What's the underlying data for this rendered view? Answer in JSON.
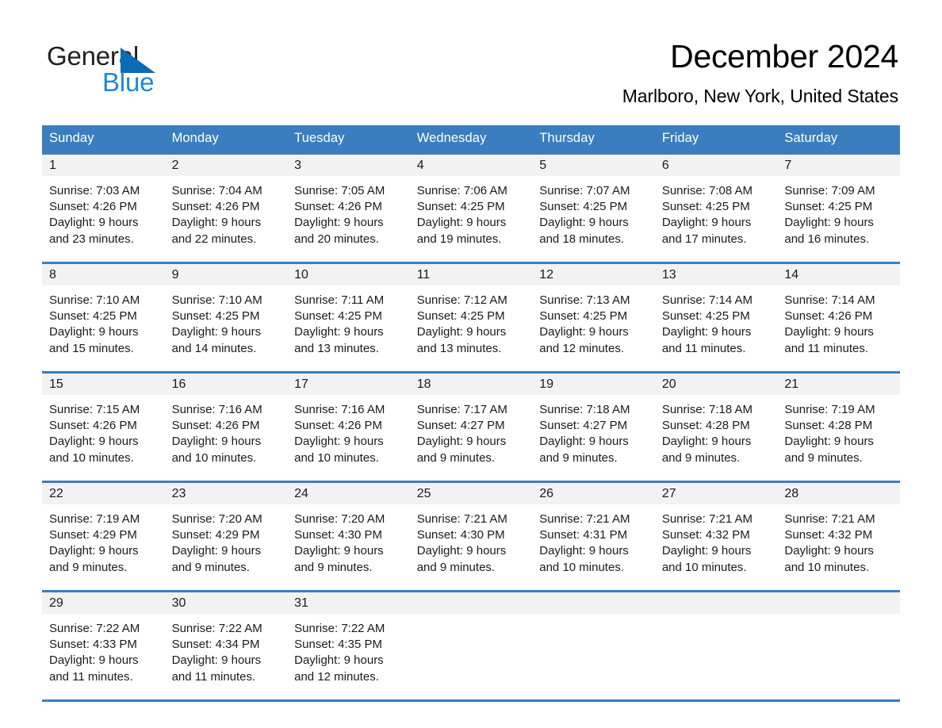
{
  "brand": {
    "name_part1": "General",
    "name_part2": "Blue",
    "triangle_color": "#0a6cb4",
    "blue_text_color": "#1c8ad4"
  },
  "header": {
    "title": "December 2024",
    "location": "Marlboro, New York, United States"
  },
  "theme": {
    "header_blue": "#3a7ebf",
    "daynum_band": "#f2f2f2",
    "text": "#1a1a1a"
  },
  "calendar": {
    "weekday_headers": [
      "Sunday",
      "Monday",
      "Tuesday",
      "Wednesday",
      "Thursday",
      "Friday",
      "Saturday"
    ],
    "weeks": [
      [
        {
          "day": "1",
          "sunrise": "Sunrise: 7:03 AM",
          "sunset": "Sunset: 4:26 PM",
          "daylight_line1": "Daylight: 9 hours",
          "daylight_line2": "and 23 minutes."
        },
        {
          "day": "2",
          "sunrise": "Sunrise: 7:04 AM",
          "sunset": "Sunset: 4:26 PM",
          "daylight_line1": "Daylight: 9 hours",
          "daylight_line2": "and 22 minutes."
        },
        {
          "day": "3",
          "sunrise": "Sunrise: 7:05 AM",
          "sunset": "Sunset: 4:26 PM",
          "daylight_line1": "Daylight: 9 hours",
          "daylight_line2": "and 20 minutes."
        },
        {
          "day": "4",
          "sunrise": "Sunrise: 7:06 AM",
          "sunset": "Sunset: 4:25 PM",
          "daylight_line1": "Daylight: 9 hours",
          "daylight_line2": "and 19 minutes."
        },
        {
          "day": "5",
          "sunrise": "Sunrise: 7:07 AM",
          "sunset": "Sunset: 4:25 PM",
          "daylight_line1": "Daylight: 9 hours",
          "daylight_line2": "and 18 minutes."
        },
        {
          "day": "6",
          "sunrise": "Sunrise: 7:08 AM",
          "sunset": "Sunset: 4:25 PM",
          "daylight_line1": "Daylight: 9 hours",
          "daylight_line2": "and 17 minutes."
        },
        {
          "day": "7",
          "sunrise": "Sunrise: 7:09 AM",
          "sunset": "Sunset: 4:25 PM",
          "daylight_line1": "Daylight: 9 hours",
          "daylight_line2": "and 16 minutes."
        }
      ],
      [
        {
          "day": "8",
          "sunrise": "Sunrise: 7:10 AM",
          "sunset": "Sunset: 4:25 PM",
          "daylight_line1": "Daylight: 9 hours",
          "daylight_line2": "and 15 minutes."
        },
        {
          "day": "9",
          "sunrise": "Sunrise: 7:10 AM",
          "sunset": "Sunset: 4:25 PM",
          "daylight_line1": "Daylight: 9 hours",
          "daylight_line2": "and 14 minutes."
        },
        {
          "day": "10",
          "sunrise": "Sunrise: 7:11 AM",
          "sunset": "Sunset: 4:25 PM",
          "daylight_line1": "Daylight: 9 hours",
          "daylight_line2": "and 13 minutes."
        },
        {
          "day": "11",
          "sunrise": "Sunrise: 7:12 AM",
          "sunset": "Sunset: 4:25 PM",
          "daylight_line1": "Daylight: 9 hours",
          "daylight_line2": "and 13 minutes."
        },
        {
          "day": "12",
          "sunrise": "Sunrise: 7:13 AM",
          "sunset": "Sunset: 4:25 PM",
          "daylight_line1": "Daylight: 9 hours",
          "daylight_line2": "and 12 minutes."
        },
        {
          "day": "13",
          "sunrise": "Sunrise: 7:14 AM",
          "sunset": "Sunset: 4:25 PM",
          "daylight_line1": "Daylight: 9 hours",
          "daylight_line2": "and 11 minutes."
        },
        {
          "day": "14",
          "sunrise": "Sunrise: 7:14 AM",
          "sunset": "Sunset: 4:26 PM",
          "daylight_line1": "Daylight: 9 hours",
          "daylight_line2": "and 11 minutes."
        }
      ],
      [
        {
          "day": "15",
          "sunrise": "Sunrise: 7:15 AM",
          "sunset": "Sunset: 4:26 PM",
          "daylight_line1": "Daylight: 9 hours",
          "daylight_line2": "and 10 minutes."
        },
        {
          "day": "16",
          "sunrise": "Sunrise: 7:16 AM",
          "sunset": "Sunset: 4:26 PM",
          "daylight_line1": "Daylight: 9 hours",
          "daylight_line2": "and 10 minutes."
        },
        {
          "day": "17",
          "sunrise": "Sunrise: 7:16 AM",
          "sunset": "Sunset: 4:26 PM",
          "daylight_line1": "Daylight: 9 hours",
          "daylight_line2": "and 10 minutes."
        },
        {
          "day": "18",
          "sunrise": "Sunrise: 7:17 AM",
          "sunset": "Sunset: 4:27 PM",
          "daylight_line1": "Daylight: 9 hours",
          "daylight_line2": "and 9 minutes."
        },
        {
          "day": "19",
          "sunrise": "Sunrise: 7:18 AM",
          "sunset": "Sunset: 4:27 PM",
          "daylight_line1": "Daylight: 9 hours",
          "daylight_line2": "and 9 minutes."
        },
        {
          "day": "20",
          "sunrise": "Sunrise: 7:18 AM",
          "sunset": "Sunset: 4:28 PM",
          "daylight_line1": "Daylight: 9 hours",
          "daylight_line2": "and 9 minutes."
        },
        {
          "day": "21",
          "sunrise": "Sunrise: 7:19 AM",
          "sunset": "Sunset: 4:28 PM",
          "daylight_line1": "Daylight: 9 hours",
          "daylight_line2": "and 9 minutes."
        }
      ],
      [
        {
          "day": "22",
          "sunrise": "Sunrise: 7:19 AM",
          "sunset": "Sunset: 4:29 PM",
          "daylight_line1": "Daylight: 9 hours",
          "daylight_line2": "and 9 minutes."
        },
        {
          "day": "23",
          "sunrise": "Sunrise: 7:20 AM",
          "sunset": "Sunset: 4:29 PM",
          "daylight_line1": "Daylight: 9 hours",
          "daylight_line2": "and 9 minutes."
        },
        {
          "day": "24",
          "sunrise": "Sunrise: 7:20 AM",
          "sunset": "Sunset: 4:30 PM",
          "daylight_line1": "Daylight: 9 hours",
          "daylight_line2": "and 9 minutes."
        },
        {
          "day": "25",
          "sunrise": "Sunrise: 7:21 AM",
          "sunset": "Sunset: 4:30 PM",
          "daylight_line1": "Daylight: 9 hours",
          "daylight_line2": "and 9 minutes."
        },
        {
          "day": "26",
          "sunrise": "Sunrise: 7:21 AM",
          "sunset": "Sunset: 4:31 PM",
          "daylight_line1": "Daylight: 9 hours",
          "daylight_line2": "and 10 minutes."
        },
        {
          "day": "27",
          "sunrise": "Sunrise: 7:21 AM",
          "sunset": "Sunset: 4:32 PM",
          "daylight_line1": "Daylight: 9 hours",
          "daylight_line2": "and 10 minutes."
        },
        {
          "day": "28",
          "sunrise": "Sunrise: 7:21 AM",
          "sunset": "Sunset: 4:32 PM",
          "daylight_line1": "Daylight: 9 hours",
          "daylight_line2": "and 10 minutes."
        }
      ],
      [
        {
          "day": "29",
          "sunrise": "Sunrise: 7:22 AM",
          "sunset": "Sunset: 4:33 PM",
          "daylight_line1": "Daylight: 9 hours",
          "daylight_line2": "and 11 minutes."
        },
        {
          "day": "30",
          "sunrise": "Sunrise: 7:22 AM",
          "sunset": "Sunset: 4:34 PM",
          "daylight_line1": "Daylight: 9 hours",
          "daylight_line2": "and 11 minutes."
        },
        {
          "day": "31",
          "sunrise": "Sunrise: 7:22 AM",
          "sunset": "Sunset: 4:35 PM",
          "daylight_line1": "Daylight: 9 hours",
          "daylight_line2": "and 12 minutes."
        },
        {
          "day": "",
          "sunrise": "",
          "sunset": "",
          "daylight_line1": "",
          "daylight_line2": ""
        },
        {
          "day": "",
          "sunrise": "",
          "sunset": "",
          "daylight_line1": "",
          "daylight_line2": ""
        },
        {
          "day": "",
          "sunrise": "",
          "sunset": "",
          "daylight_line1": "",
          "daylight_line2": ""
        },
        {
          "day": "",
          "sunrise": "",
          "sunset": "",
          "daylight_line1": "",
          "daylight_line2": ""
        }
      ]
    ]
  }
}
